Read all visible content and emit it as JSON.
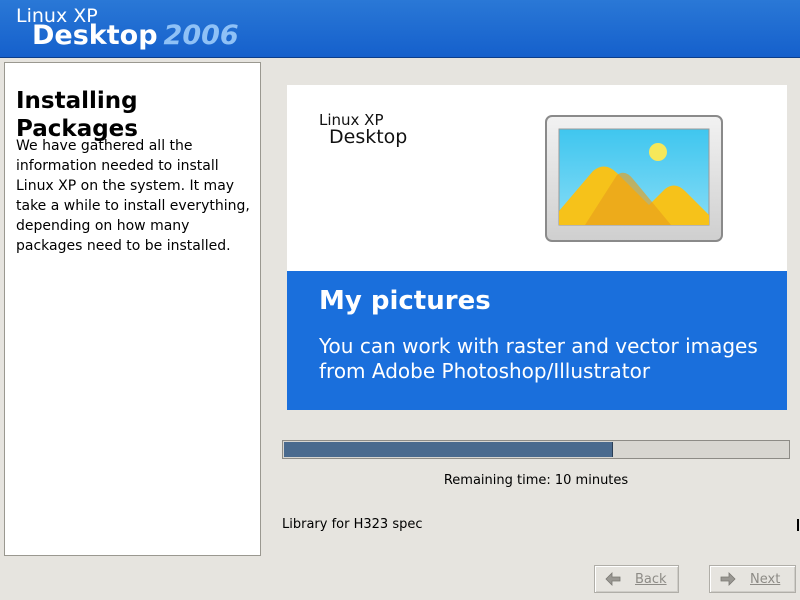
{
  "header": {
    "brand_small": "Linux XP",
    "brand_big": "Desktop",
    "brand_year": "2006",
    "colors": {
      "background": "#1a63cf",
      "year": "#8fc1f6"
    }
  },
  "sidebar": {
    "title": "Installing Packages",
    "description": "We have gathered all the information needed to install Linux XP on the system. It may take a while to install everything, depending on how many packages need to be installed."
  },
  "banner": {
    "logo_small": "Linux XP",
    "logo_big": "Desktop",
    "icon": "picture-frame-icon",
    "heading": "My pictures",
    "text": "You can work with raster and vector images from Adobe Photoshop/Illustrator",
    "colors": {
      "panel": "#1a6fdc"
    }
  },
  "progress": {
    "fraction": 0.65,
    "remaining": "Remaining time: 10 minutes",
    "current_package": "Library for H323 spec"
  },
  "buttons": {
    "back": {
      "label": "Back",
      "icon": "arrow-left-icon",
      "enabled": false
    },
    "next": {
      "label": "Next",
      "icon": "arrow-right-icon",
      "enabled": false
    }
  }
}
